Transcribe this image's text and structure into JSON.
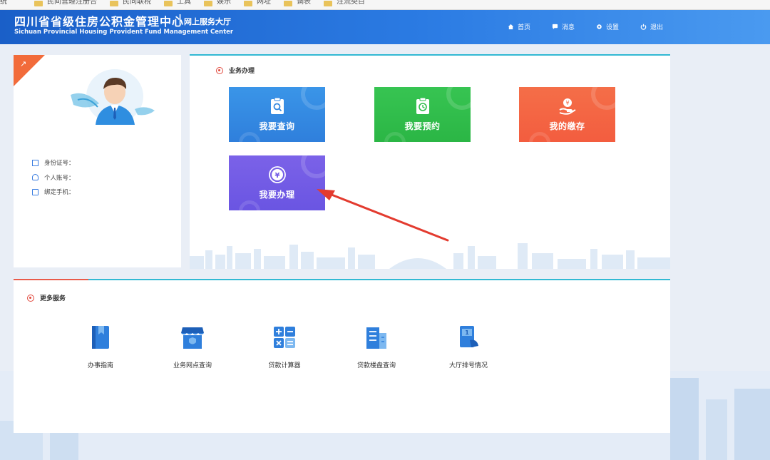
{
  "bookmarks": [
    "统",
    "民间营理注册合",
    "民同联税",
    "工具",
    "娱乐",
    "网址",
    "调表",
    "注流类目"
  ],
  "header": {
    "title_cn": "四川省省级住房公积金管理中心",
    "title_sep": "|",
    "title_sub": "网上服务大厅",
    "title_en": "Sichuan Provincial Housing Provident Fund Management Center",
    "nav": [
      {
        "label": "首页",
        "icon": "home-icon"
      },
      {
        "label": "消息",
        "icon": "message-icon"
      },
      {
        "label": "设置",
        "icon": "gear-icon"
      },
      {
        "label": "退出",
        "icon": "power-icon"
      }
    ]
  },
  "profile": {
    "fields": [
      {
        "label": "身份证号：",
        "icon": "id-card-icon"
      },
      {
        "label": "个人账号：",
        "icon": "user-icon"
      },
      {
        "label": "绑定手机：",
        "icon": "phone-icon"
      }
    ]
  },
  "business": {
    "title": "业务办理",
    "tiles": [
      {
        "label": "我要查询",
        "icon": "search-document-icon",
        "color": "#3388e0"
      },
      {
        "label": "我要预约",
        "icon": "clock-clipboard-icon",
        "color": "#30bd4b"
      },
      {
        "label": "我的缴存",
        "icon": "coin-hand-icon",
        "color": "#f36543"
      },
      {
        "label": "我要办理",
        "icon": "yuan-coin-icon",
        "color": "#725be5"
      }
    ]
  },
  "more": {
    "title": "更多服务",
    "items": [
      {
        "label": "办事指南",
        "icon": "guide-book-icon"
      },
      {
        "label": "业务网点查询",
        "icon": "branch-store-icon"
      },
      {
        "label": "贷款计算器",
        "icon": "calculator-icon"
      },
      {
        "label": "贷款楼盘查询",
        "icon": "building-icon"
      },
      {
        "label": "大厅排号情况",
        "icon": "queue-ticket-icon"
      }
    ]
  },
  "colors": {
    "header_blue": "#2b7be3",
    "accent_red": "#e2483c",
    "accent_cyan": "#32b9d3",
    "icon_blue": "#2f7fdc"
  }
}
